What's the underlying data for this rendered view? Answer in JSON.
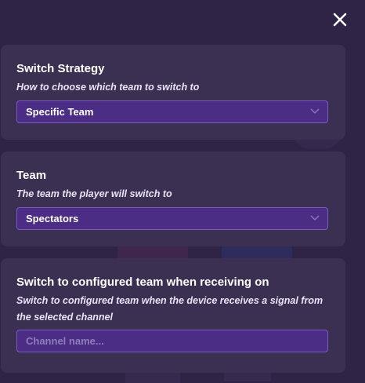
{
  "close": {
    "icon": "close-icon"
  },
  "switch_strategy": {
    "title": "Switch Strategy",
    "description": "How to choose which team to switch to",
    "selected": "Specific Team",
    "chevron_icon": "chevron-down-icon"
  },
  "team": {
    "title": "Team",
    "description": "The team the player will switch to",
    "selected": "Spectators",
    "chevron_icon": "chevron-down-icon"
  },
  "channel": {
    "title": "Switch to configured team when receiving on",
    "description": "Switch to configured team when the device receives a signal from the selected channel",
    "value": "",
    "placeholder": "Channel name..."
  },
  "colors": {
    "background": "#2f2446",
    "card": "#3b3052",
    "field": "#4b2d86",
    "field_border": "#7a5cc0",
    "placeholder": "#8f7dba"
  }
}
